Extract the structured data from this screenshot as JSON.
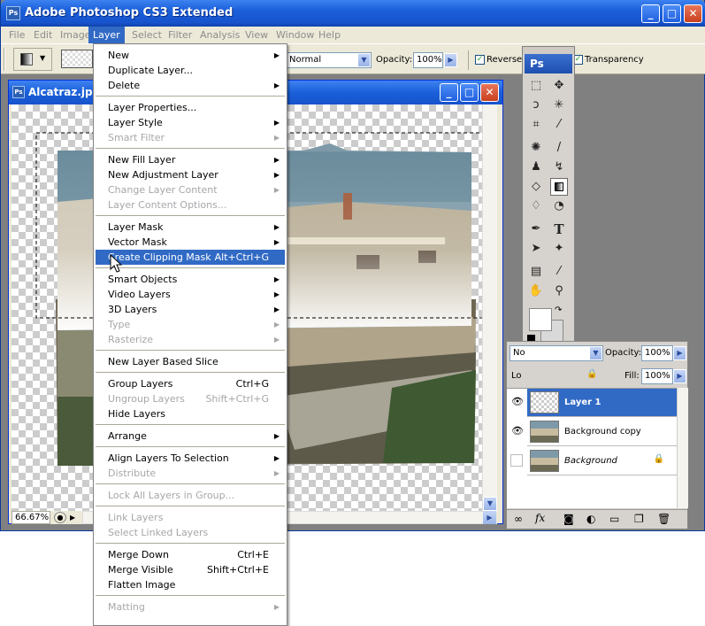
{
  "app": {
    "title": "Adobe Photoshop CS3 Extended",
    "logo": "Ps"
  },
  "menubar": [
    "File",
    "Edit",
    "Image",
    "Layer",
    "Select",
    "Filter",
    "Analysis",
    "View",
    "Window",
    "Help"
  ],
  "options": {
    "mode_value": "Normal",
    "opacity_label": "Opacity:",
    "opacity_value": "100%",
    "reverse_label": "Reverse",
    "transparency_label": "Transparency"
  },
  "document": {
    "title": "Alcatraz.jpg",
    "zoom": "66.67%"
  },
  "layer_menu": {
    "items": [
      {
        "label": "New",
        "submenu": true,
        "disabled": false
      },
      {
        "label": "Duplicate Layer...",
        "disabled": false
      },
      {
        "label": "Delete",
        "submenu": true,
        "disabled": false
      },
      {
        "sep": true
      },
      {
        "label": "Layer Properties...",
        "disabled": false
      },
      {
        "label": "Layer Style",
        "submenu": true,
        "disabled": false
      },
      {
        "label": "Smart Filter",
        "submenu": true,
        "disabled": true
      },
      {
        "sep": true
      },
      {
        "label": "New Fill Layer",
        "submenu": true,
        "disabled": false
      },
      {
        "label": "New Adjustment Layer",
        "submenu": true,
        "disabled": false
      },
      {
        "label": "Change Layer Content",
        "submenu": true,
        "disabled": true
      },
      {
        "label": "Layer Content Options...",
        "disabled": true
      },
      {
        "sep": true
      },
      {
        "label": "Layer Mask",
        "submenu": true,
        "disabled": false
      },
      {
        "label": "Vector Mask",
        "submenu": true,
        "disabled": false
      },
      {
        "label": "Create Clipping Mask",
        "shortcut": "Alt+Ctrl+G",
        "highlighted": true,
        "disabled": false
      },
      {
        "sep": true
      },
      {
        "label": "Smart Objects",
        "submenu": true,
        "disabled": false
      },
      {
        "label": "Video Layers",
        "submenu": true,
        "disabled": false
      },
      {
        "label": "3D Layers",
        "submenu": true,
        "disabled": false
      },
      {
        "label": "Type",
        "submenu": true,
        "disabled": true
      },
      {
        "label": "Rasterize",
        "submenu": true,
        "disabled": true
      },
      {
        "sep": true
      },
      {
        "label": "New Layer Based Slice",
        "disabled": false
      },
      {
        "sep": true
      },
      {
        "label": "Group Layers",
        "shortcut": "Ctrl+G",
        "disabled": false
      },
      {
        "label": "Ungroup Layers",
        "shortcut": "Shift+Ctrl+G",
        "disabled": true
      },
      {
        "label": "Hide Layers",
        "disabled": false
      },
      {
        "sep": true
      },
      {
        "label": "Arrange",
        "submenu": true,
        "disabled": false
      },
      {
        "sep": true
      },
      {
        "label": "Align Layers To Selection",
        "submenu": true,
        "disabled": false
      },
      {
        "label": "Distribute",
        "submenu": true,
        "disabled": true
      },
      {
        "sep": true
      },
      {
        "label": "Lock All Layers in Group...",
        "disabled": true
      },
      {
        "sep": true
      },
      {
        "label": "Link Layers",
        "disabled": true
      },
      {
        "label": "Select Linked Layers",
        "disabled": true
      },
      {
        "sep": true
      },
      {
        "label": "Merge Down",
        "shortcut": "Ctrl+E",
        "disabled": false
      },
      {
        "label": "Merge Visible",
        "shortcut": "Shift+Ctrl+E",
        "disabled": false
      },
      {
        "label": "Flatten Image",
        "disabled": false
      },
      {
        "sep": true
      },
      {
        "label": "Matting",
        "submenu": true,
        "disabled": true
      }
    ]
  },
  "toolbox": {
    "title": "Ps"
  },
  "layers_panel": {
    "blend_mode": "No",
    "opacity_label": "Opacity:",
    "opacity_value": "100%",
    "lock_label": "Lo",
    "fill_label": "Fill:",
    "fill_value": "100%",
    "layers": [
      {
        "name": "Layer 1",
        "selected": true,
        "visible": true
      },
      {
        "name": "Background copy",
        "selected": false,
        "visible": true
      },
      {
        "name": "Background",
        "selected": false,
        "visible": false,
        "locked": true
      }
    ]
  },
  "colors": {
    "xp_blue": "#1a5fd9",
    "menu_highlight": "#316ac5",
    "panel_gray": "#d6d3ce"
  }
}
